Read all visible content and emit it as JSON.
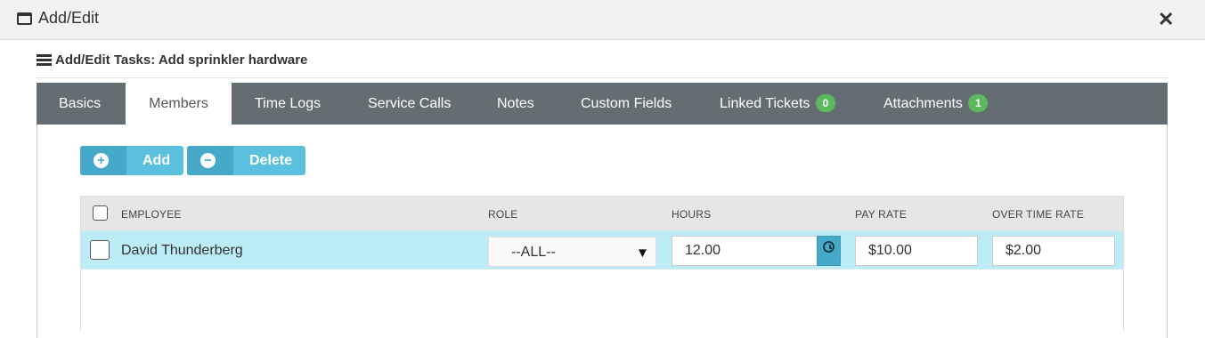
{
  "window": {
    "title": "Add/Edit",
    "window_icon": "window-icon",
    "close_label": "✕"
  },
  "section": {
    "title": "Add/Edit Tasks: Add sprinkler hardware",
    "icon": "list-icon"
  },
  "tabs": [
    {
      "label": "Basics"
    },
    {
      "label": "Members",
      "active": true
    },
    {
      "label": "Time Logs"
    },
    {
      "label": "Service Calls"
    },
    {
      "label": "Notes"
    },
    {
      "label": "Custom Fields"
    },
    {
      "label": "Linked Tickets",
      "badge": "0"
    },
    {
      "label": "Attachments",
      "badge": "1"
    }
  ],
  "actions": {
    "add_label": "Add",
    "add_icon": "plus-circle-icon",
    "delete_label": "Delete",
    "delete_icon": "minus-circle-icon"
  },
  "table": {
    "columns": [
      "EMPLOYEE",
      "ROLE",
      "HOURS",
      "PAY RATE",
      "OVER TIME RATE"
    ],
    "rows": [
      {
        "employee": "David Thunderberg",
        "role": "--ALL--",
        "hours": "12.00",
        "pay_rate": "$10.00",
        "over_time_rate": "$2.00"
      }
    ]
  },
  "colors": {
    "tab_bar": "#646e72",
    "button": "#5bc0de",
    "button_icon_box": "#46a9c9",
    "badge": "#5cb85c",
    "selected_row": "#bcecf6",
    "header_row": "#e6e6e6"
  }
}
